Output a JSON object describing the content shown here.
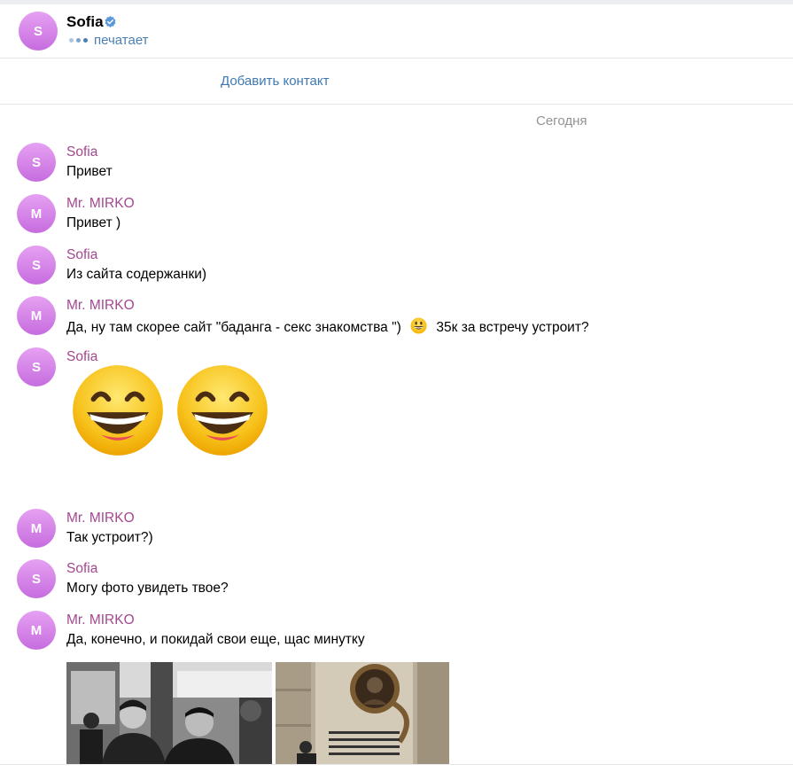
{
  "header": {
    "avatar_letter": "S",
    "name": "Sofia",
    "verified_icon": "verified-badge-icon",
    "status": "печатает"
  },
  "add_contact": {
    "label": "Добавить контакт"
  },
  "date_separator": "Сегодня",
  "messages": [
    {
      "avatar_letter": "S",
      "sender": "Sofia",
      "text": "Привет"
    },
    {
      "avatar_letter": "M",
      "sender": "Mr. MIRKO",
      "text": "Привет )"
    },
    {
      "avatar_letter": "S",
      "sender": "Sofia",
      "text": "Из сайта содержанки)"
    },
    {
      "avatar_letter": "M",
      "sender": "Mr. MIRKO",
      "text_before": "Да, ну там скорее сайт \"баданга - секс знакомства \")",
      "emoji": "grinning-face-icon",
      "text_after": "35к за встречу устроит?"
    },
    {
      "avatar_letter": "S",
      "sender": "Sofia",
      "stickers": [
        "grinning-squinting-face-icon",
        "grinning-squinting-face-icon"
      ]
    },
    {
      "avatar_letter": "M",
      "sender": "Mr. MIRKO",
      "text": "Так устроит?)"
    },
    {
      "avatar_letter": "S",
      "sender": "Sofia",
      "text": "Могу фото увидеть твое?"
    },
    {
      "avatar_letter": "M",
      "sender": "Mr. MIRKO",
      "text": "Да, конечно,  и покидай свои еще, щас минутку"
    }
  ],
  "photos": [
    "photo-two-men-restaurant",
    "photo-memorial-plaque"
  ],
  "colors": {
    "sender_name": "#a4488f",
    "link": "#3f78b3",
    "status": "#4a7fb5",
    "avatar_top": "#e6a1f2",
    "avatar_bottom": "#c66cdf"
  }
}
